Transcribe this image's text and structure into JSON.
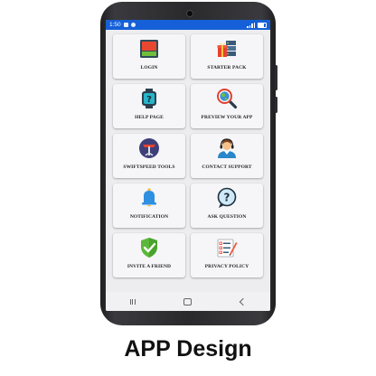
{
  "status_bar": {
    "time": "1:50"
  },
  "menu": [
    {
      "label": "LOGIN",
      "icon": "login-icon"
    },
    {
      "label": "STARTER PACK",
      "icon": "starter-pack-icon"
    },
    {
      "label": "HELP PAGE",
      "icon": "help-watch-icon"
    },
    {
      "label": "PREVIEW YOUR APP",
      "icon": "magnifier-globe-icon"
    },
    {
      "label": "SWIFTSPEED TOOLS",
      "icon": "tools-icon"
    },
    {
      "label": "CONTACT SUPPORT",
      "icon": "support-agent-icon"
    },
    {
      "label": "NOTIFICATION",
      "icon": "bell-icon"
    },
    {
      "label": "ASK QUESTION",
      "icon": "question-bubble-icon"
    },
    {
      "label": "INVITE A FRIEND",
      "icon": "shield-check-icon"
    },
    {
      "label": "PRIVACY POLICY",
      "icon": "checklist-icon"
    }
  ],
  "caption": "APP Design",
  "colors": {
    "status_bar": "#1560d8",
    "screen_bg": "#ededf0"
  }
}
